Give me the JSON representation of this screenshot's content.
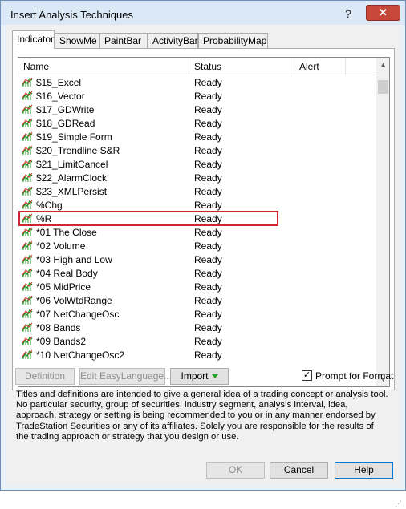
{
  "window": {
    "title": "Insert Analysis Techniques",
    "help_glyph": "?",
    "close_glyph": "✕"
  },
  "tabs": [
    "Indicator",
    "ShowMe",
    "PaintBar",
    "ActivityBar",
    "ProbabilityMap"
  ],
  "active_tab": "Indicator",
  "list": {
    "columns": [
      "Name",
      "Status",
      "Alert"
    ],
    "rows": [
      {
        "name": "$15_Excel",
        "status": "Ready"
      },
      {
        "name": "$16_Vector",
        "status": "Ready"
      },
      {
        "name": "$17_GDWrite",
        "status": "Ready"
      },
      {
        "name": "$18_GDRead",
        "status": "Ready"
      },
      {
        "name": "$19_Simple Form",
        "status": "Ready"
      },
      {
        "name": "$20_Trendline S&R",
        "status": "Ready"
      },
      {
        "name": "$21_LimitCancel",
        "status": "Ready"
      },
      {
        "name": "$22_AlarmClock",
        "status": "Ready"
      },
      {
        "name": "$23_XMLPersist",
        "status": "Ready"
      },
      {
        "name": "%Chg",
        "status": "Ready"
      },
      {
        "name": "%R",
        "status": "Ready"
      },
      {
        "name": "*01 The Close",
        "status": "Ready"
      },
      {
        "name": "*02 Volume",
        "status": "Ready"
      },
      {
        "name": "*03 High and Low",
        "status": "Ready"
      },
      {
        "name": "*04 Real Body",
        "status": "Ready"
      },
      {
        "name": "*05 MidPrice",
        "status": "Ready"
      },
      {
        "name": "*06 VolWtdRange",
        "status": "Ready"
      },
      {
        "name": "*07 NetChangeOsc",
        "status": "Ready"
      },
      {
        "name": "*08 Bands",
        "status": "Ready"
      },
      {
        "name": "*09 Bands2",
        "status": "Ready"
      },
      {
        "name": "*10 NetChangeOsc2",
        "status": "Ready"
      }
    ],
    "selected_index": 10
  },
  "buttons": {
    "definition": "Definition",
    "edit": "Edit EasyLanguage...",
    "import": "Import",
    "ok": "OK",
    "cancel": "Cancel",
    "help": "Help"
  },
  "prompt_for_format": {
    "label": "Prompt for Format",
    "checked": true,
    "check_glyph": "✓"
  },
  "disclaimer": "Titles and definitions are intended to give a general idea of a trading concept or analysis tool. No particular security, group of securities, industry segment, analysis interval, idea, approach, strategy or setting is being recommended to you or in any manner endorsed by TradeStation Securities or any of its affiliates. Solely you are responsible for the results of the trading approach or strategy that you design or use.",
  "colors": {
    "indicator_icon": "#2e9b2e",
    "indicator_icon_accent": "#d32f2f",
    "selection_border": "#d0262f",
    "close_button": "#c7473a"
  },
  "icons": {
    "row_icon": "indicator-chart-icon",
    "scroll_up": "scroll-up-arrow-icon",
    "scroll_down": "scroll-down-arrow-icon",
    "resize": "resize-grip-icon",
    "import_caret": "dropdown-caret-icon"
  }
}
